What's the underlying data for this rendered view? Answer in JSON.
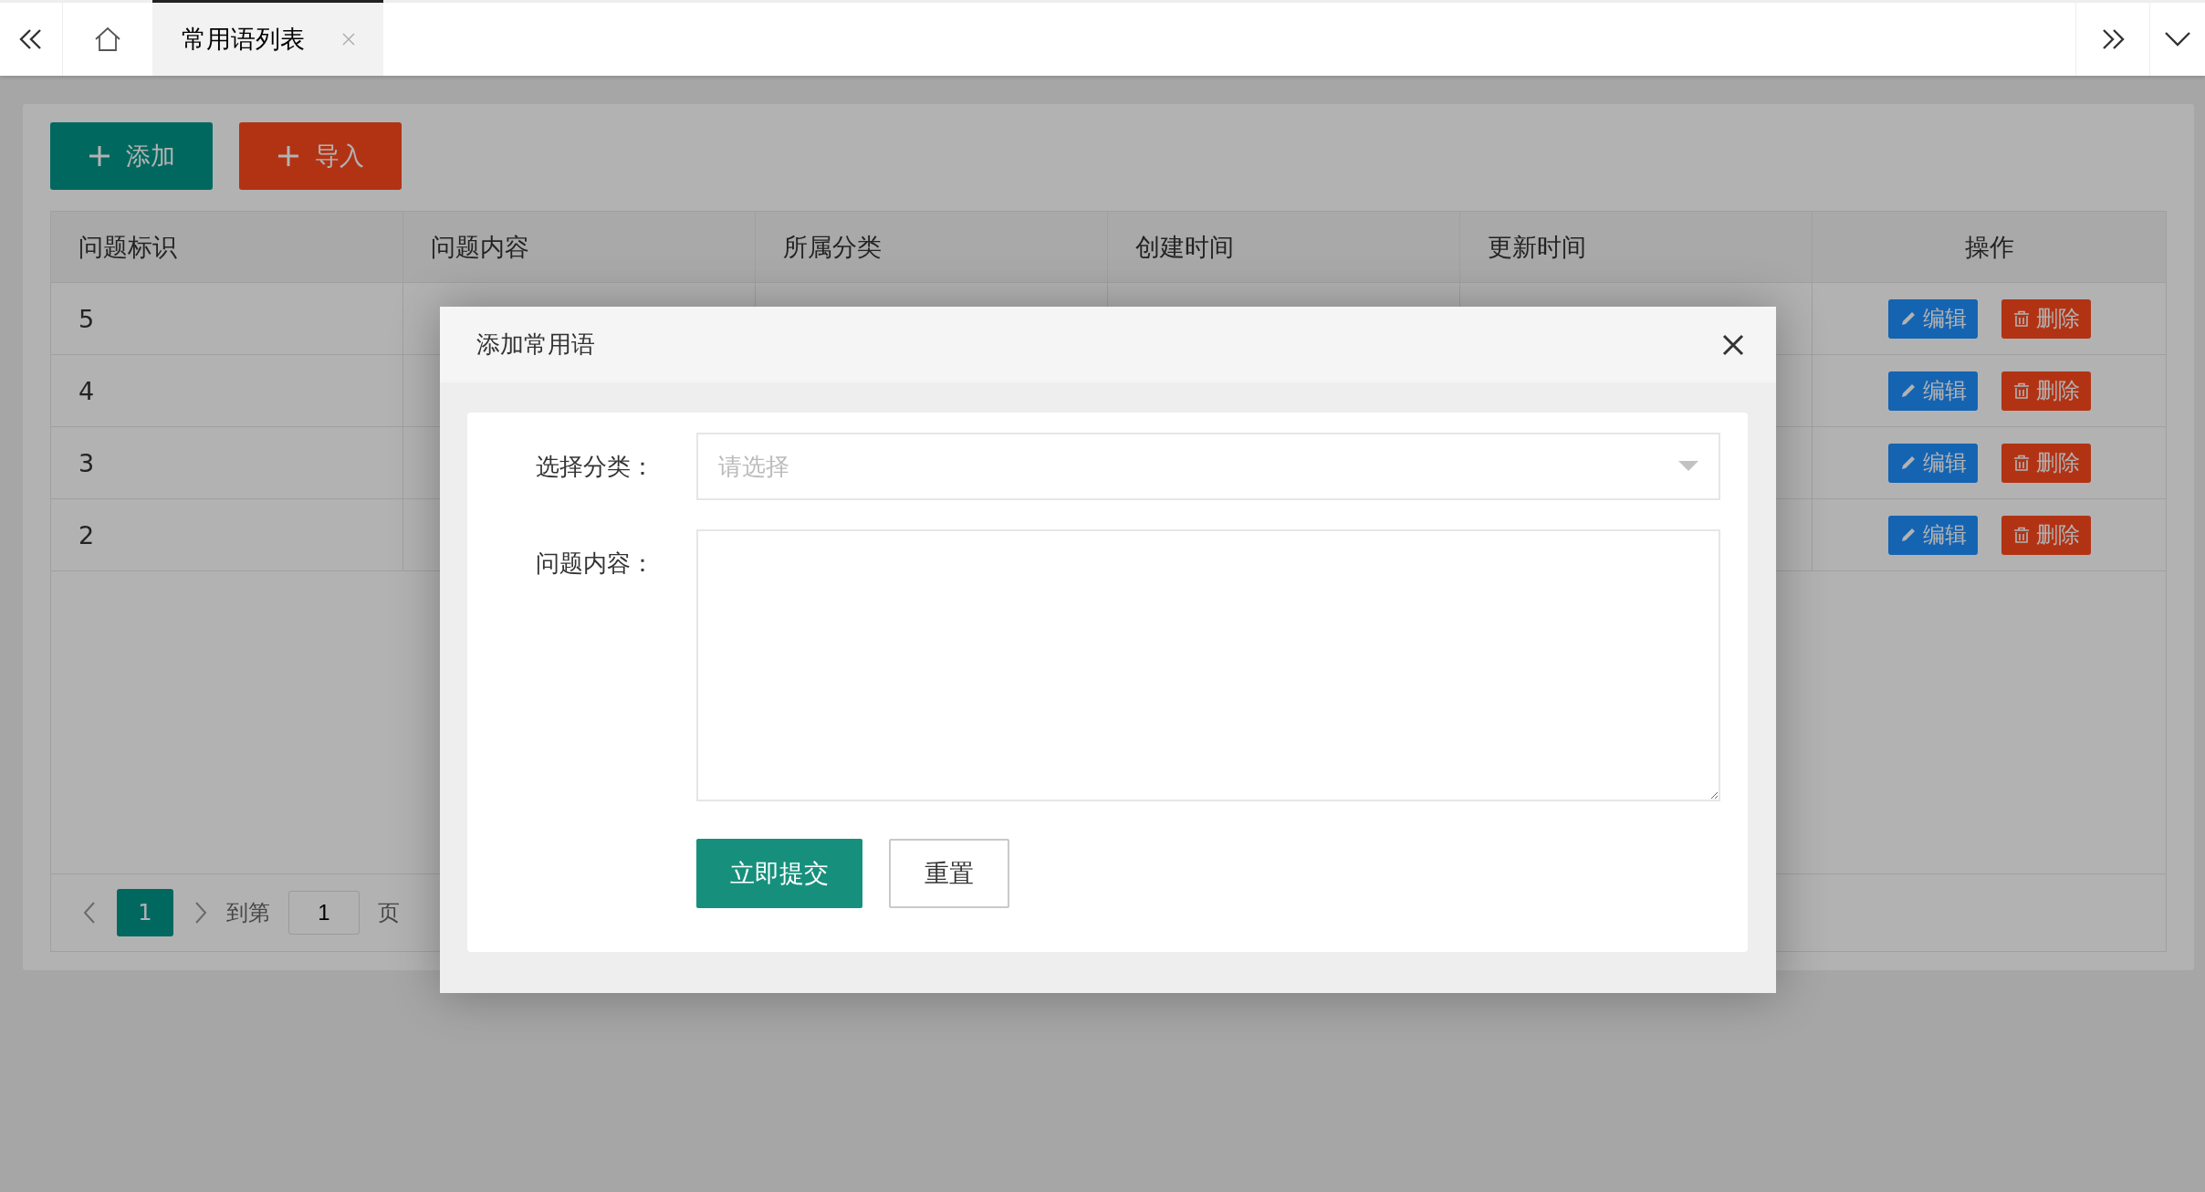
{
  "tab_bar": {
    "tabs": [
      {
        "label": "常用语列表",
        "selected": true
      }
    ]
  },
  "toolbar": {
    "buttons": [
      {
        "label": "添加",
        "kind": "add"
      },
      {
        "label": "导入",
        "kind": "import"
      }
    ]
  },
  "table": {
    "columns": [
      "问题标识",
      "问题内容",
      "所属分类",
      "创建时间",
      "更新时间",
      "操作"
    ],
    "rows": [
      {
        "id": "5",
        "actions": [
          {
            "label": "编辑",
            "kind": "edit"
          },
          {
            "label": "删除",
            "kind": "delete"
          }
        ]
      },
      {
        "id": "4",
        "actions": [
          {
            "label": "编辑",
            "kind": "edit"
          },
          {
            "label": "删除",
            "kind": "delete"
          }
        ]
      },
      {
        "id": "3",
        "actions": [
          {
            "label": "编辑",
            "kind": "edit"
          },
          {
            "label": "删除",
            "kind": "delete"
          }
        ]
      },
      {
        "id": "2",
        "actions": [
          {
            "label": "编辑",
            "kind": "edit"
          },
          {
            "label": "删除",
            "kind": "delete"
          }
        ]
      }
    ]
  },
  "pagination": {
    "pages": [
      {
        "label": "1",
        "selected": true
      }
    ],
    "goto_label": "到第",
    "goto_value": "1",
    "page_unit": "页"
  },
  "dialog": {
    "title": "添加常用语",
    "fields": [
      {
        "label": "选择分类：",
        "kind": "select",
        "placeholder": "请选择"
      },
      {
        "label": "问题内容：",
        "kind": "textarea"
      }
    ],
    "buttons": [
      {
        "label": "立即提交",
        "kind": "primary"
      },
      {
        "label": "重置",
        "kind": "default"
      }
    ]
  }
}
